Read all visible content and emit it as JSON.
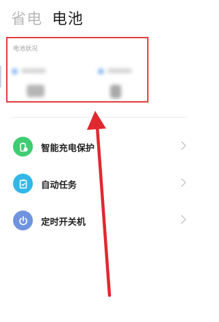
{
  "header": {
    "tabs": [
      {
        "label": "省电",
        "active": false
      },
      {
        "label": "电池",
        "active": true
      }
    ]
  },
  "battery_status": {
    "title": "电池状况"
  },
  "menu": {
    "items": [
      {
        "label": "智能充电保护",
        "icon": "battery-shield-icon",
        "color": "#3fcc72"
      },
      {
        "label": "自动任务",
        "icon": "clipboard-check-icon",
        "color": "#33b7e8"
      },
      {
        "label": "定时开关机",
        "icon": "power-icon",
        "color": "#6f93de"
      }
    ]
  },
  "colors": {
    "highlight_border": "#e23b3b",
    "annotation_arrow": "#e0292f"
  }
}
